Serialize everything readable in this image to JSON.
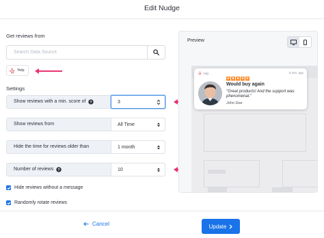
{
  "header": {
    "title": "Edit Nudge"
  },
  "source": {
    "section_label": "Get reviews from",
    "search_placeholder": "Search Data Source",
    "search_icon": "search-icon",
    "selected_source": {
      "label": "Yelp",
      "icon": "yelp-logo-icon"
    }
  },
  "settings": {
    "section_label": "Settings",
    "rows": [
      {
        "label": "Show reviews with a min. score of",
        "has_help": true,
        "value": "3",
        "control": "stepper"
      },
      {
        "label": "Show reviews from",
        "has_help": false,
        "value": "All Time",
        "control": "select"
      },
      {
        "label": "Hide the time for reviews older than",
        "has_help": false,
        "value": "1 month",
        "control": "select"
      },
      {
        "label": "Number of reviews",
        "has_help": true,
        "value": "10",
        "control": "select"
      }
    ],
    "checkboxes": [
      {
        "label": "Hide reviews without a message",
        "checked": true
      },
      {
        "label": "Randomly rotate reviews",
        "checked": true
      }
    ]
  },
  "preview": {
    "label": "Preview",
    "view_modes": [
      "desktop-icon",
      "mobile-icon"
    ],
    "active_view": "desktop",
    "nudge": {
      "source": "Yelp",
      "time": "5 min. ago",
      "rating": 5,
      "headline": "Would buy again",
      "quote": "\"Great products! And the support was phenomenal.\"",
      "author": "John Doe"
    }
  },
  "footer": {
    "cancel_label": "Cancel",
    "update_label": "Update"
  },
  "colors": {
    "accent": "#1a73e8",
    "arrow": "#e8336e",
    "star": "#ff8a2b",
    "row_bg": "#eef1f6"
  }
}
